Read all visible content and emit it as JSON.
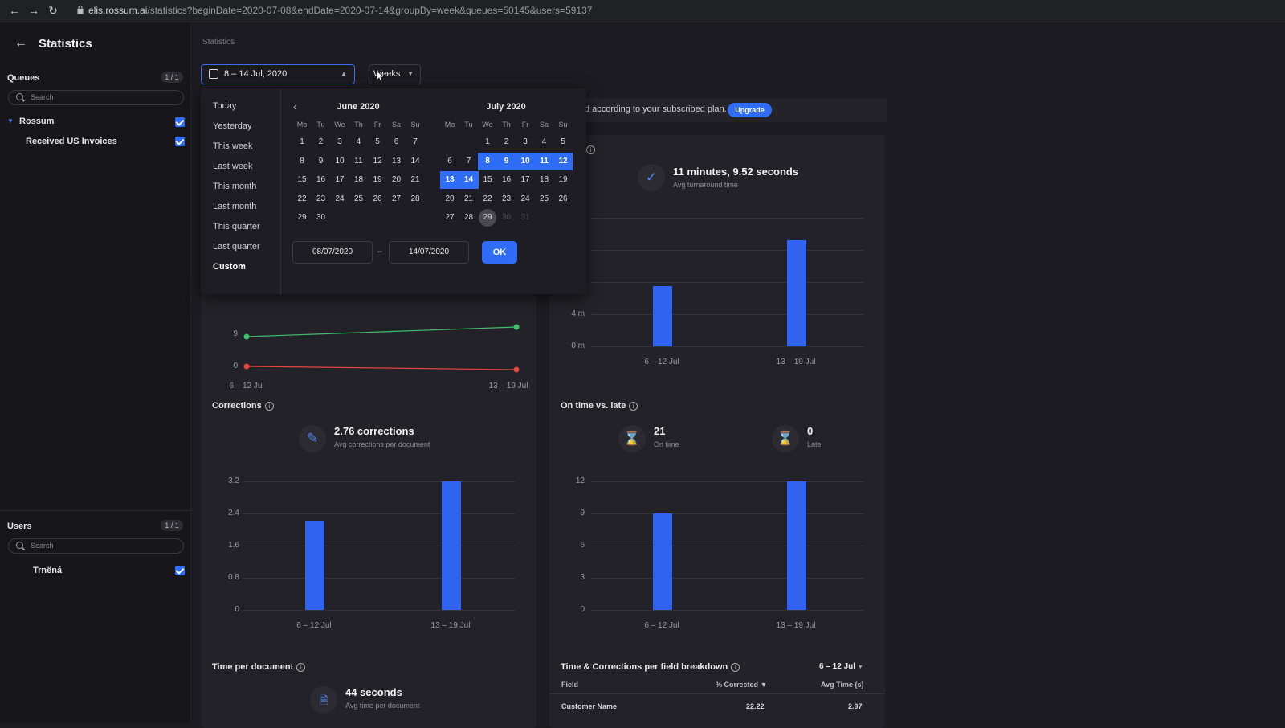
{
  "browser": {
    "url_host": "elis.rossum.ai",
    "url_path": "/statistics?beginDate=2020-07-08&endDate=2020-07-14&groupBy=week&queues=50145&users=59137"
  },
  "sidebar": {
    "title": "Statistics",
    "queues": {
      "title": "Queues",
      "count": "1 / 1",
      "search_placeholder": "Search",
      "group": "Rossum",
      "item": "Received US Invoices"
    },
    "users": {
      "title": "Users",
      "count": "1 / 1",
      "search_placeholder": "Search",
      "item": "Trnёná"
    }
  },
  "main": {
    "breadcrumb": "Statistics",
    "date_range": "8 – 14 Jul, 2020",
    "group_by": "Weeks",
    "banner_text": "d according to your subscribed plan.",
    "upgrade_label": "Upgrade"
  },
  "calendar": {
    "presets": [
      "Today",
      "Yesterday",
      "This week",
      "Last week",
      "This month",
      "Last month",
      "This quarter",
      "Last quarter",
      "Custom"
    ],
    "dow": [
      "Mo",
      "Tu",
      "We",
      "Th",
      "Fr",
      "Sa",
      "Su"
    ],
    "left_month": "June 2020",
    "right_month": "July 2020",
    "june_days": [
      "1",
      "2",
      "3",
      "4",
      "5",
      "6",
      "7",
      "8",
      "9",
      "10",
      "11",
      "12",
      "13",
      "14",
      "15",
      "16",
      "17",
      "18",
      "19",
      "20",
      "21",
      "22",
      "23",
      "24",
      "25",
      "26",
      "27",
      "28",
      "29",
      "30"
    ],
    "july_days": [
      "1",
      "2",
      "3",
      "4",
      "5",
      "6",
      "7",
      "8",
      "9",
      "10",
      "11",
      "12",
      "13",
      "14",
      "15",
      "16",
      "17",
      "18",
      "19",
      "20",
      "21",
      "22",
      "23",
      "24",
      "25",
      "26",
      "27",
      "28",
      "29",
      "30",
      "31"
    ],
    "selected_start": 8,
    "selected_end": 14,
    "today": 29,
    "start_input": "08/07/2020",
    "end_input": "14/07/2020",
    "ok_label": "OK"
  },
  "turnaround": {
    "value": "11 minutes, 9.52 seconds",
    "sub": "Avg turnaround time",
    "yticks": [
      "4 m",
      "0 m"
    ],
    "xlabels": [
      "6 – 12 Jul",
      "13 – 19 Jul"
    ]
  },
  "volume": {
    "yticks": [
      "9",
      "0"
    ],
    "xlabels": [
      "6 – 12 Jul",
      "13 – 19 Jul"
    ]
  },
  "corrections": {
    "title": "Corrections",
    "value": "2.76 corrections",
    "sub": "Avg corrections per document",
    "yticks": [
      "3.2",
      "2.4",
      "1.6",
      "0.8",
      "0"
    ],
    "xlabels": [
      "6 – 12 Jul",
      "13 – 19 Jul"
    ]
  },
  "ontime": {
    "title": "On time vs. late",
    "ontime_value": "21",
    "ontime_label": "On time",
    "late_value": "0",
    "late_label": "Late",
    "yticks": [
      "12",
      "9",
      "6",
      "3",
      "0"
    ],
    "xlabels": [
      "6 – 12 Jul",
      "13 – 19 Jul"
    ]
  },
  "time_per_doc": {
    "title": "Time per document",
    "value": "44 seconds",
    "sub": "Avg time per document"
  },
  "breakdown": {
    "title": "Time & Corrections per field breakdown",
    "period": "6 – 12 Jul",
    "col_field": "Field",
    "col_corrected": "% Corrected",
    "col_avg": "Avg Time (s)",
    "row_field": "Customer Name",
    "row_corrected": "22.22",
    "row_avg": "2.97"
  },
  "chart_data": [
    {
      "type": "line",
      "categories": [
        "6 – 12 Jul",
        "13 – 19 Jul"
      ],
      "series": [
        {
          "values": [
            9,
            10.5
          ]
        },
        {
          "values": [
            0,
            0
          ]
        }
      ],
      "colors": [
        "#3fbf6a",
        "#e0483e"
      ]
    },
    {
      "type": "bar",
      "categories": [
        "6 – 12 Jul",
        "13 – 19 Jul"
      ],
      "values": [
        5.7,
        10
      ],
      "ylabel_unit": "m"
    },
    {
      "type": "bar",
      "categories": [
        "6 – 12 Jul",
        "13 – 19 Jul"
      ],
      "values": [
        2.22,
        3.2
      ],
      "ylim": [
        0,
        3.2
      ]
    },
    {
      "type": "bar",
      "categories": [
        "6 – 12 Jul",
        "13 – 19 Jul"
      ],
      "values": [
        9,
        12
      ],
      "ylim": [
        0,
        12
      ]
    }
  ],
  "colors": {
    "accent": "#2f6df6",
    "bar": "#2f63f0",
    "late": "#e0483e",
    "ontime": "#3fbf6a"
  }
}
